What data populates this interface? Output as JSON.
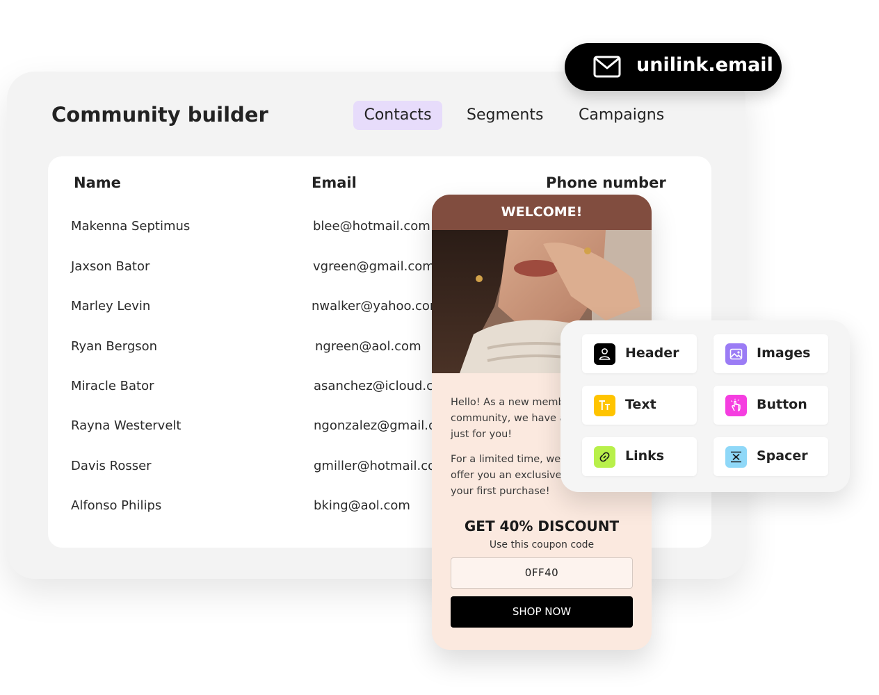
{
  "builder": {
    "title": "Community builder",
    "tabs": [
      {
        "label": "Contacts",
        "active": true
      },
      {
        "label": "Segments",
        "active": false
      },
      {
        "label": "Campaigns",
        "active": false
      }
    ],
    "tab_active_color": "#e7dcfb"
  },
  "table": {
    "columns": [
      "Name",
      "Email",
      "Phone number"
    ],
    "rows": [
      {
        "name": "Makenna Septimus",
        "email": "blee@hotmail.com"
      },
      {
        "name": "Jaxson Bator",
        "email": "vgreen@gmail.com"
      },
      {
        "name": "Marley Levin",
        "email": "nwalker@yahoo.com"
      },
      {
        "name": "Ryan Bergson",
        "email": "ngreen@aol.com"
      },
      {
        "name": "Miracle Bator",
        "email": "asanchez@icloud.com"
      },
      {
        "name": "Rayna Westervelt",
        "email": "ngonzalez@gmail.com"
      },
      {
        "name": "Davis Rosser",
        "email": "gmiller@hotmail.com"
      },
      {
        "name": "Alfonso Philips",
        "email": "bking@aol.com"
      }
    ]
  },
  "badge": {
    "icon": "mail-icon",
    "label": "unilink.email"
  },
  "email_preview": {
    "header": "WELCOME!",
    "header_color": "#814d3f",
    "background_color": "#fbe9df",
    "paragraph_1": "Hello! As a new member of our community, we have a special offer just for you!",
    "paragraph_2": "For a limited time, we're excited to offer you an exclusive discount on your first purchase!",
    "discount_title": "GET 40% DISCOUNT",
    "coupon_note": "Use this coupon code",
    "coupon_code": "0FF40",
    "cta": "SHOP NOW"
  },
  "blocks": [
    {
      "label": "Header",
      "icon": "user-icon",
      "color": "#000000"
    },
    {
      "label": "Images",
      "icon": "image-icon",
      "color": "#9b7cf5"
    },
    {
      "label": "Text",
      "icon": "text-icon",
      "color": "#ffc400"
    },
    {
      "label": "Button",
      "icon": "pointer-icon",
      "color": "#f53ee0"
    },
    {
      "label": "Links",
      "icon": "link-icon",
      "color": "#b8f04a"
    },
    {
      "label": "Spacer",
      "icon": "spacer-icon",
      "color": "#8fd8f8"
    }
  ]
}
